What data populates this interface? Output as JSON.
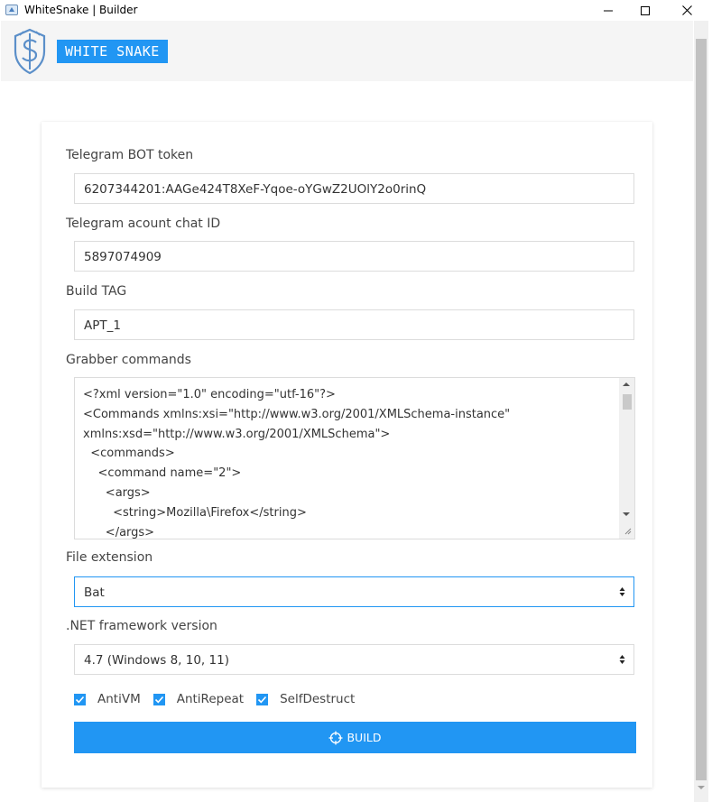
{
  "window": {
    "title": "WhiteSnake | Builder",
    "app_icon": "app-icon",
    "controls": [
      "minimize-icon",
      "maximize-icon",
      "close-icon"
    ]
  },
  "header": {
    "logo": "shield-snake-logo",
    "brand": "WHITE SNAKE"
  },
  "form": {
    "bot_token": {
      "label": "Telegram BOT token",
      "value": "6207344201:AAGe424T8XeF-Yqoe-oYGwZ2UOlY2o0rinQ"
    },
    "chat_id": {
      "label": "Telegram acount chat ID",
      "value": "5897074909"
    },
    "build_tag": {
      "label": "Build TAG",
      "value": "APT_1"
    },
    "grabber": {
      "label": "Grabber commands",
      "value": "<?xml version=\"1.0\" encoding=\"utf-16\"?>\n<Commands xmlns:xsi=\"http://www.w3.org/2001/XMLSchema-instance\" xmlns:xsd=\"http://www.w3.org/2001/XMLSchema\">\n  <commands>\n    <command name=\"2\">\n      <args>\n        <string>Mozilla\\Firefox</string>\n      </args>"
    },
    "file_extension": {
      "label": "File extension",
      "selected": "Bat"
    },
    "framework": {
      "label": ".NET framework version",
      "selected": "4.7 (Windows 8, 10, 11)"
    },
    "options": [
      {
        "label": "AntiVM",
        "checked": true
      },
      {
        "label": "AntiRepeat",
        "checked": true
      },
      {
        "label": "SelfDestruct",
        "checked": true
      }
    ],
    "build_button": {
      "label": "BUILD",
      "icon": "crosshair-icon"
    }
  },
  "colors": {
    "accent": "#2196f3",
    "header_bg": "#f5f5f5"
  }
}
